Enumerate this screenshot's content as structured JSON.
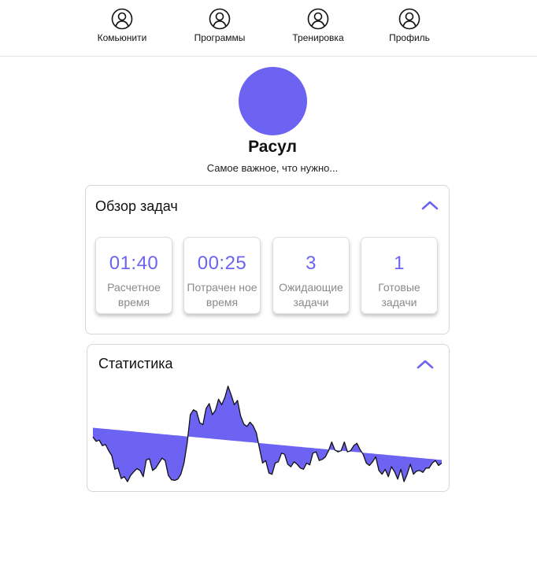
{
  "nav": {
    "items": [
      {
        "label": "Комьюнити",
        "icon": "user-circle-icon"
      },
      {
        "label": "Программы",
        "icon": "user-circle-icon"
      },
      {
        "label": "Тренировка",
        "icon": "user-circle-icon"
      },
      {
        "label": "Профиль",
        "icon": "user-circle-icon"
      }
    ]
  },
  "profile": {
    "name": "Расул",
    "subtitle": "Самое важное, что нужно...",
    "avatar_color": "#6c63f2"
  },
  "tasks_overview": {
    "title": "Обзор задач",
    "stats": [
      {
        "value": "01:40",
        "label": "Расчетное время"
      },
      {
        "value": "00:25",
        "label": "Потрачен ное время"
      },
      {
        "value": "3",
        "label": "Ожидающие задачи"
      },
      {
        "value": "1",
        "label": "Готовые задачи"
      }
    ]
  },
  "statistics": {
    "title": "Статистика"
  },
  "colors": {
    "accent": "#6c63f2"
  },
  "chart_data": {
    "type": "area",
    "x": [
      0,
      1,
      2,
      3,
      4,
      5,
      6,
      7,
      8,
      9,
      10,
      11,
      12,
      13,
      14,
      15,
      16,
      17,
      18,
      19,
      20,
      21,
      22,
      23,
      24,
      25,
      26,
      27,
      28,
      29,
      30,
      31,
      32,
      33,
      34,
      35,
      36,
      37,
      38,
      39,
      40,
      41,
      42,
      43,
      44,
      45,
      46,
      47,
      48,
      49,
      50,
      51,
      52,
      53,
      54,
      55,
      56,
      57,
      58,
      59,
      60,
      61,
      62,
      63,
      64,
      65,
      66,
      67,
      68,
      69,
      70,
      71,
      72,
      73,
      74,
      75,
      76,
      77,
      78,
      79,
      80,
      81,
      82,
      83,
      84,
      85,
      86,
      87,
      88,
      89,
      90,
      91,
      92,
      93,
      94,
      95,
      96,
      97,
      98,
      99,
      100,
      101,
      102,
      103,
      104,
      105,
      106,
      107,
      108,
      109,
      110,
      111
    ],
    "values": [
      72,
      65,
      67,
      58,
      60,
      50,
      42,
      20,
      22,
      5,
      8,
      0,
      10,
      16,
      21,
      18,
      8,
      35,
      37,
      18,
      22,
      30,
      38,
      34,
      10,
      3,
      2,
      4,
      12,
      30,
      62,
      108,
      116,
      113,
      95,
      92,
      118,
      126,
      108,
      115,
      133,
      124,
      136,
      154,
      140,
      124,
      131,
      106,
      93,
      89,
      96,
      90,
      79,
      54,
      30,
      34,
      14,
      12,
      30,
      32,
      46,
      44,
      28,
      24,
      32,
      28,
      22,
      20,
      30,
      27,
      46,
      48,
      34,
      36,
      40,
      50,
      64,
      51,
      48,
      50,
      64,
      48,
      50,
      58,
      62,
      52,
      44,
      30,
      26,
      32,
      40,
      18,
      12,
      20,
      8,
      24,
      16,
      4,
      20,
      0,
      12,
      28,
      12,
      17,
      18,
      15,
      22,
      22,
      30,
      34,
      26,
      30
    ],
    "trend": [
      87,
      35
    ],
    "ylim": [
      0,
      160
    ],
    "grid": false,
    "fill_color": "#6c63f2",
    "line_color": "#111111"
  }
}
